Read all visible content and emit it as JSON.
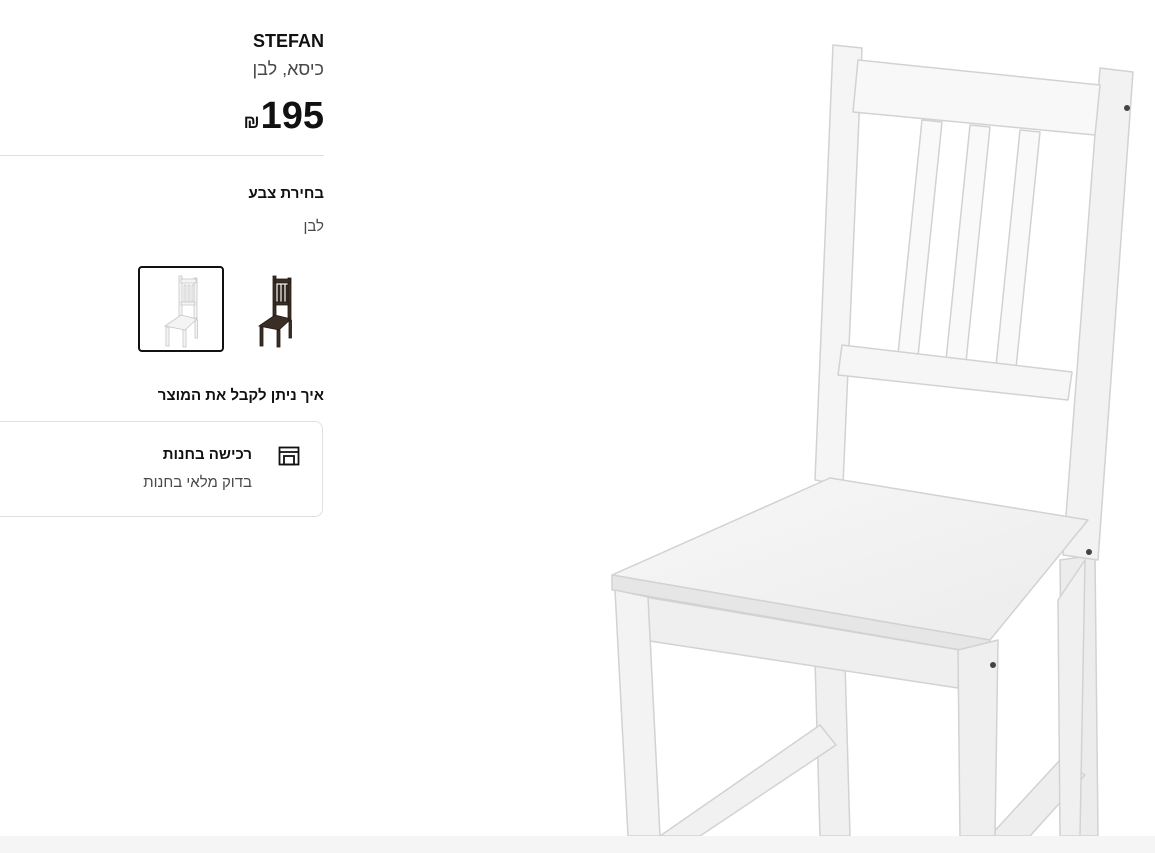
{
  "product": {
    "name": "STEFAN",
    "description": "כיסא, לבן",
    "price_symbol": "₪",
    "price_value": "195"
  },
  "color_section": {
    "title": "בחירת צבע",
    "selected_color": "לבן",
    "swatches": [
      {
        "icon": "white-chair",
        "selected": true
      },
      {
        "icon": "brown-black-chair",
        "selected": false
      }
    ]
  },
  "delivery": {
    "title": "איך ניתן לקבל את המוצר",
    "store_option": {
      "icon": "store-icon",
      "title": "רכישה בחנות",
      "subtitle": "בדוק מלאי בחנות"
    }
  },
  "colors": {
    "border": "#dfdfdf",
    "text_secondary": "#484848",
    "selected_border": "#111111"
  }
}
